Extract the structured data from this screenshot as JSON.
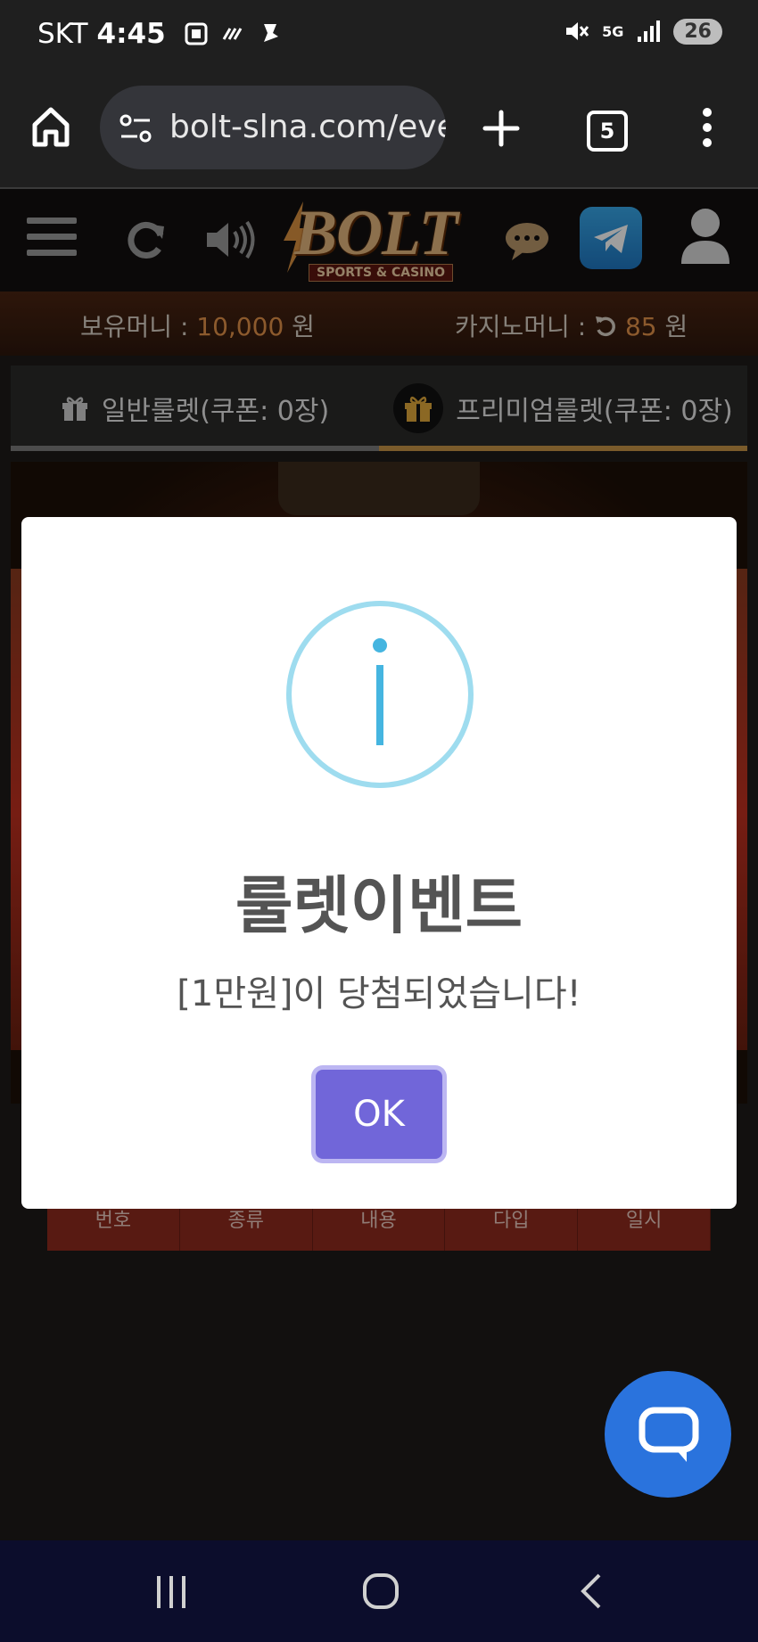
{
  "status_bar": {
    "carrier": "SKT",
    "time": "4:45",
    "network": "5G",
    "battery": "26"
  },
  "browser": {
    "url": "bolt-slna.com/eve",
    "tab_count": "5"
  },
  "site_header": {
    "logo_text": "BOLT",
    "logo_subtitle": "SPORTS & CASINO"
  },
  "balance": {
    "holding_label": "보유머니 :",
    "holding_amount": "10,000",
    "holding_unit": "원",
    "casino_label": "카지노머니 :",
    "casino_amount": "85",
    "casino_unit": "원"
  },
  "tabs": [
    {
      "label": "일반룰렛(쿠폰: 0장)"
    },
    {
      "label": "프리미엄룰렛(쿠폰: 0장)"
    }
  ],
  "table": {
    "headers": [
      "번호",
      "종류",
      "내용",
      "다입",
      "일시"
    ]
  },
  "modal": {
    "title": "룰렛이벤트",
    "message": "[1만원]이 당첨되었습니다!",
    "ok_label": "OK"
  },
  "colors": {
    "accent_orange": "#e3924a",
    "ok_button": "#7166d9",
    "info_ring": "#9edcef",
    "chat_fab": "#2a73dd"
  }
}
